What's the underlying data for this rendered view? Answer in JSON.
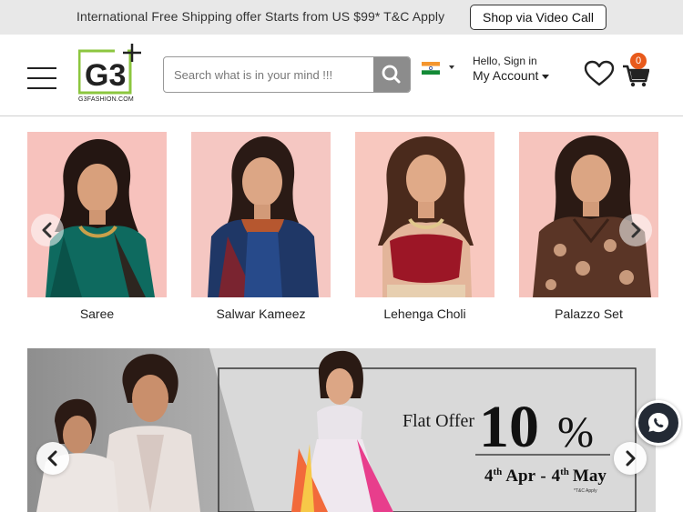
{
  "topbar": {
    "promo_text": "International Free Shipping offer Starts from US $99* T&C Apply",
    "video_call_button": "Shop via Video Call"
  },
  "header": {
    "logo_text": "G3FASHION.COM",
    "logo_mark": "G3",
    "search_placeholder": "Search what is in your mind !!!",
    "account_greeting": "Hello, Sign in",
    "account_label": "My Account",
    "cart_count": "0",
    "icons": [
      "menu-icon",
      "search-icon",
      "india-flag-icon",
      "heart-icon",
      "cart-icon"
    ]
  },
  "categories": [
    {
      "label": "Saree"
    },
    {
      "label": "Salwar Kameez"
    },
    {
      "label": "Lehenga Choli"
    },
    {
      "label": "Palazzo Set"
    }
  ],
  "banner": {
    "offer_prefix": "Flat Offer",
    "offer_value": "10",
    "offer_unit": "%",
    "date_start_day": "4",
    "date_start_suffix": "th",
    "date_start_month": "Apr",
    "date_separator": "-",
    "date_end_day": "4",
    "date_end_suffix": "th",
    "date_end_month": "May",
    "terms": "*T&C Apply"
  },
  "colors": {
    "topbar_bg": "#e8e8e8",
    "search_button": "#8c8c8c",
    "cart_badge": "#e85a1b",
    "whatsapp_bg": "#232a35",
    "logo_green": "#8cc63f"
  }
}
